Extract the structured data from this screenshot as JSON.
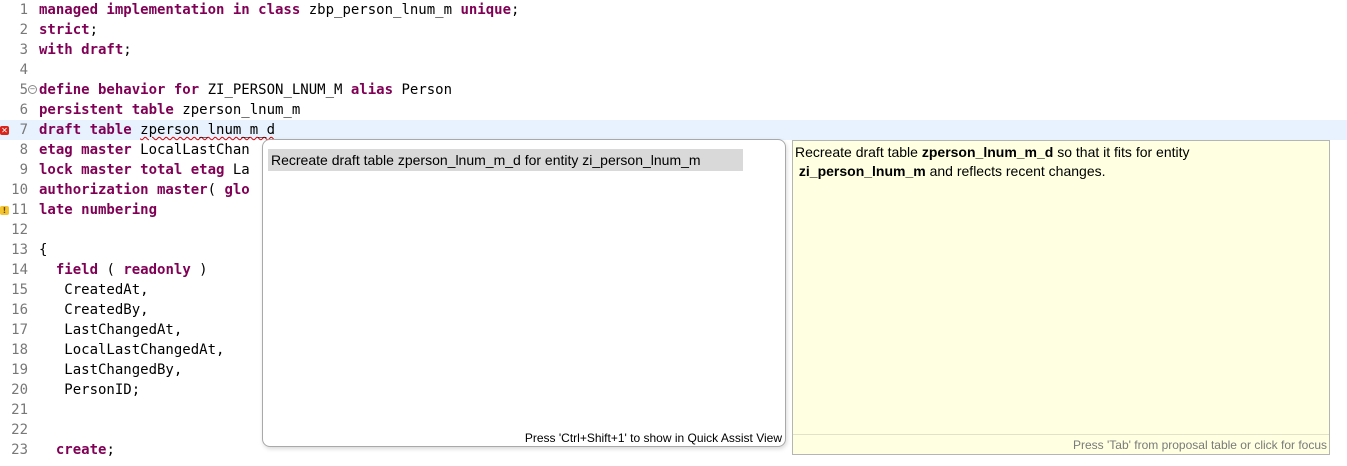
{
  "editor": {
    "lines": [
      {
        "num": "1",
        "segments": [
          [
            "kw",
            "managed implementation in class"
          ],
          [
            "tx",
            " zbp_person_lnum_m "
          ],
          [
            "kw",
            "unique"
          ],
          [
            "tx",
            ";"
          ]
        ]
      },
      {
        "num": "2",
        "segments": [
          [
            "kw",
            "strict"
          ],
          [
            "tx",
            ";"
          ]
        ]
      },
      {
        "num": "3",
        "segments": [
          [
            "kw",
            "with draft"
          ],
          [
            "tx",
            ";"
          ]
        ]
      },
      {
        "num": "4",
        "segments": []
      },
      {
        "num": "5",
        "fold": true,
        "segments": [
          [
            "kw",
            "define behavior for"
          ],
          [
            "tx",
            " ZI_PERSON_LNUM_M "
          ],
          [
            "kw",
            "alias"
          ],
          [
            "tx",
            " Person"
          ]
        ]
      },
      {
        "num": "6",
        "segments": [
          [
            "kw",
            "persistent table"
          ],
          [
            "tx",
            " zperson_lnum_m"
          ]
        ]
      },
      {
        "num": "7",
        "current": true,
        "marker": "error",
        "segments": [
          [
            "kw",
            "draft table"
          ],
          [
            "tx",
            " "
          ],
          [
            "sq",
            "zperson_lnum_m_d"
          ]
        ]
      },
      {
        "num": "8",
        "segments": [
          [
            "kw",
            "etag master"
          ],
          [
            "tx",
            " LocalLastChan"
          ]
        ]
      },
      {
        "num": "9",
        "segments": [
          [
            "kw",
            "lock master total etag"
          ],
          [
            "tx",
            " La"
          ]
        ]
      },
      {
        "num": "10",
        "segments": [
          [
            "kw",
            "authorization master"
          ],
          [
            "tx",
            "( "
          ],
          [
            "kw",
            "glo"
          ]
        ]
      },
      {
        "num": "11",
        "marker": "warning",
        "segments": [
          [
            "kw",
            "late numbering"
          ]
        ]
      },
      {
        "num": "12",
        "segments": []
      },
      {
        "num": "13",
        "segments": [
          [
            "tx",
            "{"
          ]
        ]
      },
      {
        "num": "14",
        "segments": [
          [
            "tx",
            "  "
          ],
          [
            "kw",
            "field"
          ],
          [
            "tx",
            " ( "
          ],
          [
            "kw",
            "readonly"
          ],
          [
            "tx",
            " )"
          ]
        ]
      },
      {
        "num": "15",
        "segments": [
          [
            "tx",
            "   CreatedAt,"
          ]
        ]
      },
      {
        "num": "16",
        "segments": [
          [
            "tx",
            "   CreatedBy,"
          ]
        ]
      },
      {
        "num": "17",
        "segments": [
          [
            "tx",
            "   LastChangedAt,"
          ]
        ]
      },
      {
        "num": "18",
        "segments": [
          [
            "tx",
            "   LocalLastChangedAt,"
          ]
        ]
      },
      {
        "num": "19",
        "segments": [
          [
            "tx",
            "   LastChangedBy,"
          ]
        ]
      },
      {
        "num": "20",
        "segments": [
          [
            "tx",
            "   PersonID;"
          ]
        ]
      },
      {
        "num": "21",
        "segments": []
      },
      {
        "num": "22",
        "segments": []
      },
      {
        "num": "23",
        "segments": [
          [
            "tx",
            "  "
          ],
          [
            "kw",
            "create"
          ],
          [
            "tx",
            ";"
          ]
        ]
      }
    ],
    "error_marker_glyph": "✕",
    "warning_marker_glyph": "!"
  },
  "quickfix": {
    "proposal": "Recreate draft table zperson_lnum_m_d for entity zi_person_lnum_m",
    "footer": "Press 'Ctrl+Shift+1' to show in Quick Assist View"
  },
  "info": {
    "t1": "Recreate draft table ",
    "b1": "zperson_lnum_m_d",
    "t2": " so that it fits for entity",
    "b2": "zi_person_lnum_m",
    "t3": " and reflects recent changes.",
    "footer": "Press 'Tab' from proposal table or click for focus"
  },
  "colors": {
    "keyword": "#7f0055",
    "current_line": "#e8f2fe",
    "info_background": "#ffffe1",
    "selection": "#d9d9d9"
  }
}
